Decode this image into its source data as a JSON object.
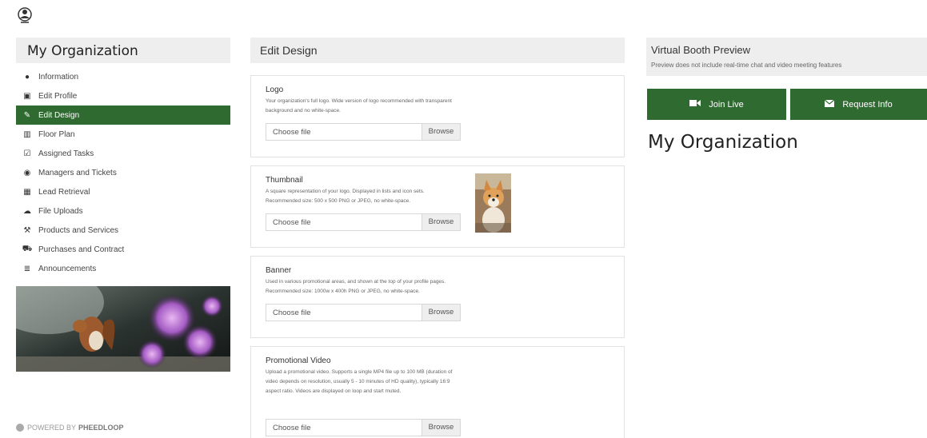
{
  "brand": {
    "logo_icon": "org-logo-icon"
  },
  "sidebar": {
    "title": "My Organization",
    "items": [
      {
        "label": "Information",
        "icon": "info-icon",
        "glyph": "●"
      },
      {
        "label": "Edit Profile",
        "icon": "edit-icon",
        "glyph": "▣"
      },
      {
        "label": "Edit Design",
        "icon": "brush-icon",
        "glyph": "✎",
        "active": true
      },
      {
        "label": "Floor Plan",
        "icon": "map-icon",
        "glyph": "▥"
      },
      {
        "label": "Assigned Tasks",
        "icon": "check-square-icon",
        "glyph": "☑"
      },
      {
        "label": "Managers and Tickets",
        "icon": "user-circle-icon",
        "glyph": "◉"
      },
      {
        "label": "Lead Retrieval",
        "icon": "qr-icon",
        "glyph": "▦"
      },
      {
        "label": "File Uploads",
        "icon": "cloud-upload-icon",
        "glyph": "☁"
      },
      {
        "label": "Products and Services",
        "icon": "wrench-icon",
        "glyph": "⚒"
      },
      {
        "label": "Purchases and Contract",
        "icon": "cart-icon",
        "glyph": "⛟"
      },
      {
        "label": "Announcements",
        "icon": "list-icon",
        "glyph": "≣"
      }
    ],
    "powered_prefix": "POWERED BY",
    "powered_brand": "PHEEDLOOP"
  },
  "edit_design": {
    "title": "Edit Design",
    "file_placeholder": "Choose file",
    "browse_label": "Browse",
    "sections": [
      {
        "title": "Logo",
        "description": "Your organization's full logo. Wide version of logo recommended with transparent background and no white-space."
      },
      {
        "title": "Thumbnail",
        "description": "A square representation of your logo. Displayed in lists and icon sets. Recommended size: 500 x 500 PNG or JPEG, no white-space."
      },
      {
        "title": "Banner",
        "description": "Used in various promotional areas, and shown at the top of your profile pages. Recommended size: 1000w x 400h PNG or JPEG, no white-space."
      },
      {
        "title": "Promotional Video",
        "description": "Upload a promotional video. Supports a single MP4 file up to 100 MB (duration of video depends on resolution, usually 5 - 10 minutes of HD quality), typically 16:9 aspect ratio. Videos are displayed on loop and start muted."
      }
    ]
  },
  "preview": {
    "title": "Virtual Booth Preview",
    "subtitle": "Preview does not include real-time chat and video meeting features",
    "join_label": "Join Live",
    "request_label": "Request Info",
    "org_name": "My Organization"
  },
  "colors": {
    "accent": "#2f6b31",
    "panel": "#eeeeee"
  }
}
